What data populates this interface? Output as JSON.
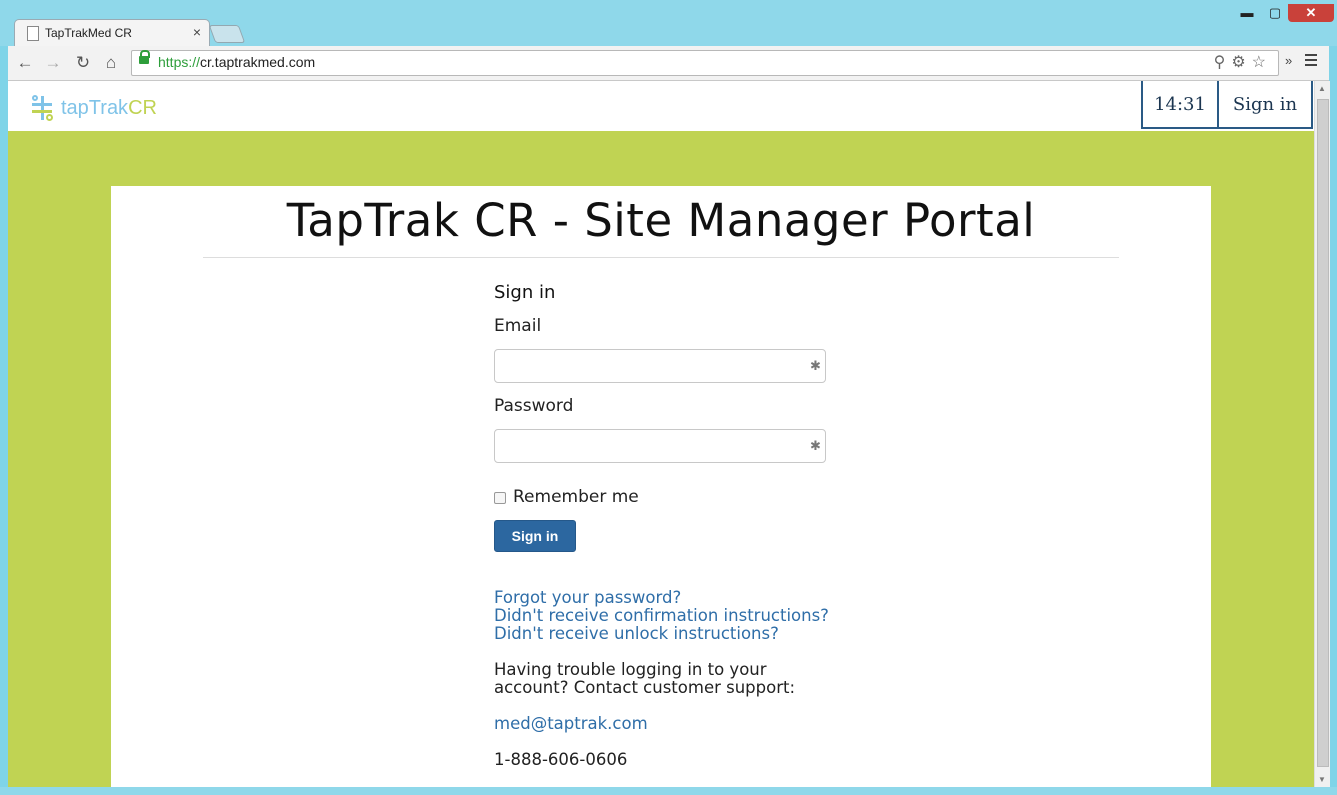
{
  "browser": {
    "tab_title": "TapTrakMed CR",
    "tab_close": "×",
    "window_min": "▬",
    "window_max": "▢",
    "window_close": "✕",
    "url_scheme": "https://",
    "url_host": "cr.taptrakmed.com",
    "omnibox_icons": "⚲⚙☆",
    "extensions_label": "»",
    "back": "←",
    "forward": "→",
    "reload": "↻",
    "home": "⌂"
  },
  "nav": {
    "brand_main": "tapTrak",
    "brand_accent": "CR",
    "clock": "14:31",
    "signin": "Sign in"
  },
  "page": {
    "title": "TapTrak CR - Site Manager Portal"
  },
  "form": {
    "heading": "Sign in",
    "email_label": "Email",
    "email_value": "",
    "password_label": "Password",
    "password_value": "",
    "field_badge": "✱",
    "remember_label": "Remember me",
    "submit_label": "Sign in"
  },
  "links": {
    "forgot": "Forgot your password?",
    "confirmation": "Didn't receive confirmation instructions?",
    "unlock": "Didn't receive unlock instructions?"
  },
  "support": {
    "text": "Having trouble logging in to your account? Contact customer support:",
    "email": "med@taptrak.com",
    "phone": "1-888-606-0606"
  },
  "colors": {
    "accent_green": "#c0d353",
    "brand_blue": "#7fc3e8",
    "button_blue": "#2c67a0",
    "link_blue": "#2f6ea8"
  }
}
